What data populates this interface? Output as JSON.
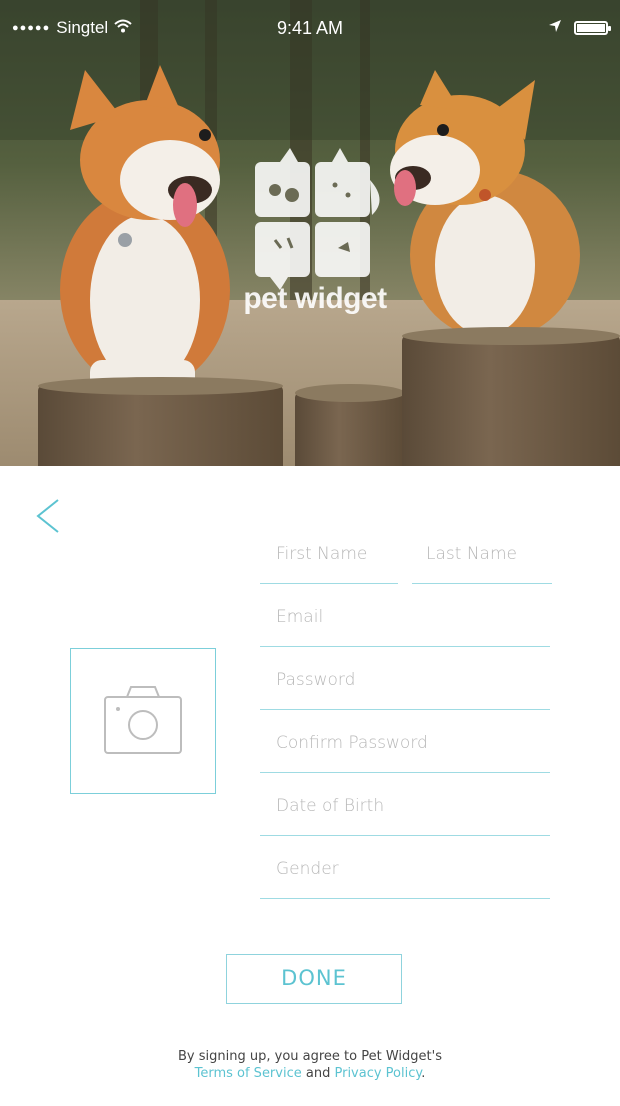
{
  "status_bar": {
    "carrier": "Singtel",
    "signal_dots": "●●●●●",
    "time": "9:41 AM"
  },
  "brand": {
    "app_name": "pet widget"
  },
  "form": {
    "first_name": {
      "placeholder": "First Name",
      "value": ""
    },
    "last_name": {
      "placeholder": "Last Name",
      "value": ""
    },
    "email": {
      "placeholder": "Email",
      "value": ""
    },
    "password": {
      "placeholder": "Password",
      "value": ""
    },
    "confirm_password": {
      "placeholder": "Confirm Password",
      "value": ""
    },
    "date_of_birth": {
      "placeholder": "Date of Birth",
      "value": ""
    },
    "gender": {
      "placeholder": "Gender",
      "value": ""
    }
  },
  "actions": {
    "done_label": "DONE"
  },
  "legal": {
    "prefix": "By signing up, you agree to Pet Widget's",
    "terms_link": "Terms of Service",
    "and_text": "and",
    "privacy_link": "Privacy Policy",
    "suffix": "."
  },
  "icons": {
    "back": "chevron-left-icon",
    "camera": "camera-icon",
    "wifi": "wifi-icon",
    "location": "location-arrow-icon",
    "battery": "battery-icon"
  },
  "colors": {
    "accent": "#5cc3d1",
    "field_line": "#9fdbe3",
    "placeholder": "#b7b7b7"
  }
}
